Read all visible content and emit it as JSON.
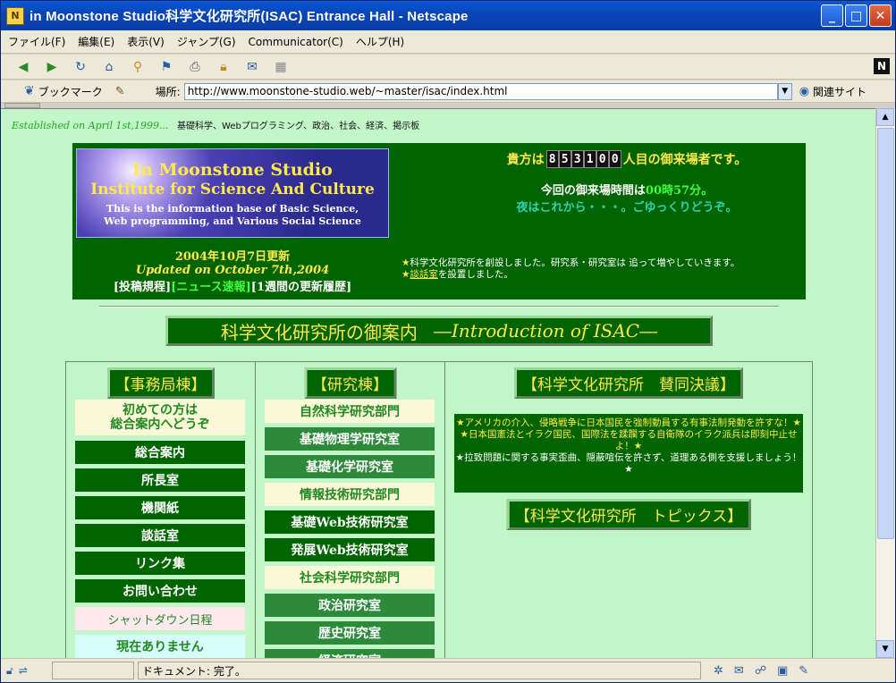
{
  "window": {
    "title": "in Moonstone Studio科学文化研究所(ISAC) Entrance Hall - Netscape",
    "buttons": {
      "minimize": "_",
      "maximize": "□",
      "close": "✕"
    }
  },
  "menu": [
    "ファイル(F)",
    "編集(E)",
    "表示(V)",
    "ジャンプ(G)",
    "Communicator(C)",
    "ヘルプ(H)"
  ],
  "toolbar": {
    "icons": [
      "back-icon",
      "forward-icon",
      "reload-icon",
      "home-icon",
      "search-icon",
      "netscape-icon",
      "print-icon",
      "security-icon",
      "shop-icon",
      "stop-icon"
    ],
    "logo": "N"
  },
  "location": {
    "bookmarks": "ブックマーク",
    "label": "場所:",
    "url": "http://www.moonstone-studio.web/~master/isac/index.html",
    "related": "関連サイト"
  },
  "page": {
    "established": "Established on April 1st,1999...",
    "topics_line": "基礎科学、Webプログラミング、政治、社会、経済、掲示板",
    "logo": {
      "line1": "In Moonstone Studio",
      "line2": "Institute for Science And Culture",
      "line3": "This is the information base of Basic Science,",
      "line4": "Web programming, and Various Social Science"
    },
    "updated_jp": "2004年10月7日更新",
    "updated_en": "Updated on October 7th,2004",
    "header_links": [
      "[投稿規程]",
      "[ニュース速報]",
      "[1週間の更新履歴]"
    ],
    "visitor": {
      "prefix": "貴方は",
      "count_digits": [
        "8",
        "5",
        "3",
        "1",
        "0",
        "0"
      ],
      "suffix": "人目の御来場者です。",
      "time_prefix": "今回の御来場時間は",
      "time": "00時57分。",
      "greeting": "夜はこれから・・・。ごゆっくりどうぞ。"
    },
    "news": [
      {
        "star": "★",
        "text": "科学文化研究所を創設しました。研究系・研究室は 追って増やしていきます。"
      },
      {
        "star": "★",
        "link": "談話室",
        "text": "を設置しました。"
      }
    ],
    "intro_title_jp": "科学文化研究所の御案内",
    "intro_title_en": "―Introduction of ISAC―",
    "office": {
      "heading": "【事務局棟】",
      "first_time_line1": "初めての方は",
      "first_time_line2": "総合案内へどうぞ",
      "items": [
        "総合案内",
        "所長室",
        "機関紙",
        "談話室",
        "リンク集",
        "お問い合わせ"
      ],
      "shutdown": "シャットダウン日程",
      "none": "現在ありません"
    },
    "research": {
      "heading": "【研究棟】",
      "items": [
        {
          "label": "自然科学研究部門",
          "style": "cream"
        },
        {
          "label": "基礎物理学研究室",
          "style": "mid"
        },
        {
          "label": "基礎化学研究室",
          "style": "mid"
        },
        {
          "label": "情報技術研究部門",
          "style": "cream"
        },
        {
          "label": "基礎Web技術研究室",
          "style": "dark"
        },
        {
          "label": "発展Web技術研究室",
          "style": "dark"
        },
        {
          "label": "社会科学研究部門",
          "style": "cream"
        },
        {
          "label": "政治研究室",
          "style": "mid"
        },
        {
          "label": "歴史研究室",
          "style": "mid"
        },
        {
          "label": "経済研究室",
          "style": "mid"
        }
      ]
    },
    "resolution": {
      "heading": "【科学文化研究所　賛同決議】",
      "lines": [
        {
          "s1": "★",
          "text": "アメリカの介入、侵略戦争に日本国民を強制動員する有事法制発動を許すな！",
          "s2": "★",
          "yellow": true
        },
        {
          "s1": "★",
          "text": "日本国憲法とイラク国民、国際法を蹂躙する自衛隊のイラク派兵は即刻中止せよ！",
          "s2": "★",
          "yellow": true
        },
        {
          "s1": "★",
          "text": "拉致問題に関する事実歪曲、隠蔽喧伝を許さず、道理ある側を支援しましょう！",
          "s2": "★",
          "yellow": false
        }
      ],
      "topics_heading": "【科学文化研究所　トピックス】"
    }
  },
  "status": {
    "message": "ドキュメント: 完了。"
  },
  "colors": {
    "page_bg": "#c2f5c8",
    "dark_green": "#006400",
    "yellow": "#ffe94a",
    "bright_green": "#40ff40"
  }
}
